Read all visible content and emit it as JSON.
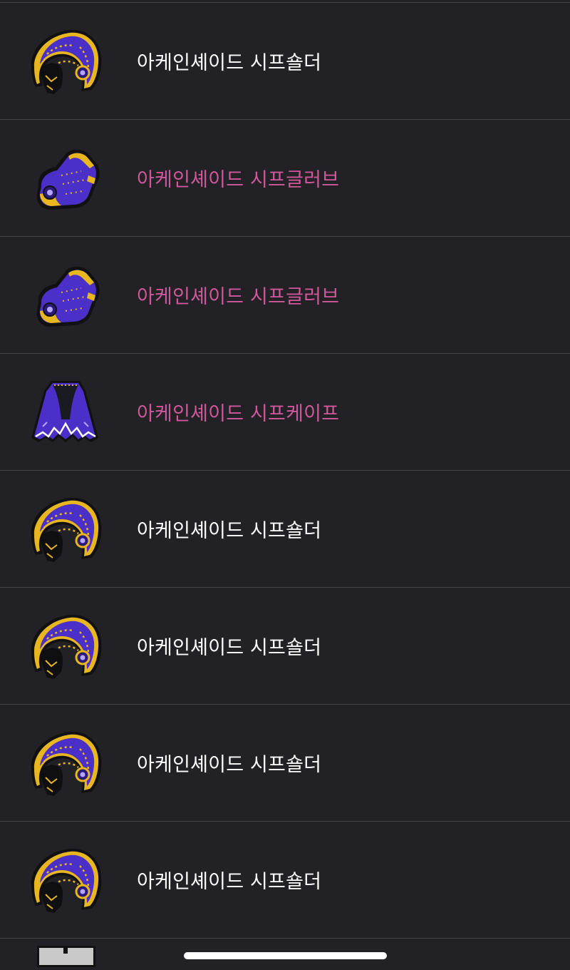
{
  "items": [
    {
      "name": "아케인셰이드 시프숄더",
      "rarity": "normal",
      "icon": "shoulder-icon"
    },
    {
      "name": "아케인셰이드 시프글러브",
      "rarity": "rare",
      "icon": "glove-icon"
    },
    {
      "name": "아케인셰이드 시프글러브",
      "rarity": "rare",
      "icon": "glove-icon"
    },
    {
      "name": "아케인셰이드 시프케이프",
      "rarity": "rare",
      "icon": "cape-icon"
    },
    {
      "name": "아케인셰이드 시프숄더",
      "rarity": "normal",
      "icon": "shoulder-icon"
    },
    {
      "name": "아케인셰이드 시프숄더",
      "rarity": "normal",
      "icon": "shoulder-icon"
    },
    {
      "name": "아케인셰이드 시프숄더",
      "rarity": "normal",
      "icon": "shoulder-icon"
    },
    {
      "name": "아케인셰이드 시프숄더",
      "rarity": "normal",
      "icon": "shoulder-icon"
    }
  ],
  "partial_item": {
    "icon": "box-icon"
  },
  "colors": {
    "background": "#212126",
    "divider": "#45454e",
    "normal_text": "#ffffff",
    "rare_text": "#d0589a",
    "item_purple": "#4a2fc9",
    "item_gold": "#e8b61f"
  }
}
